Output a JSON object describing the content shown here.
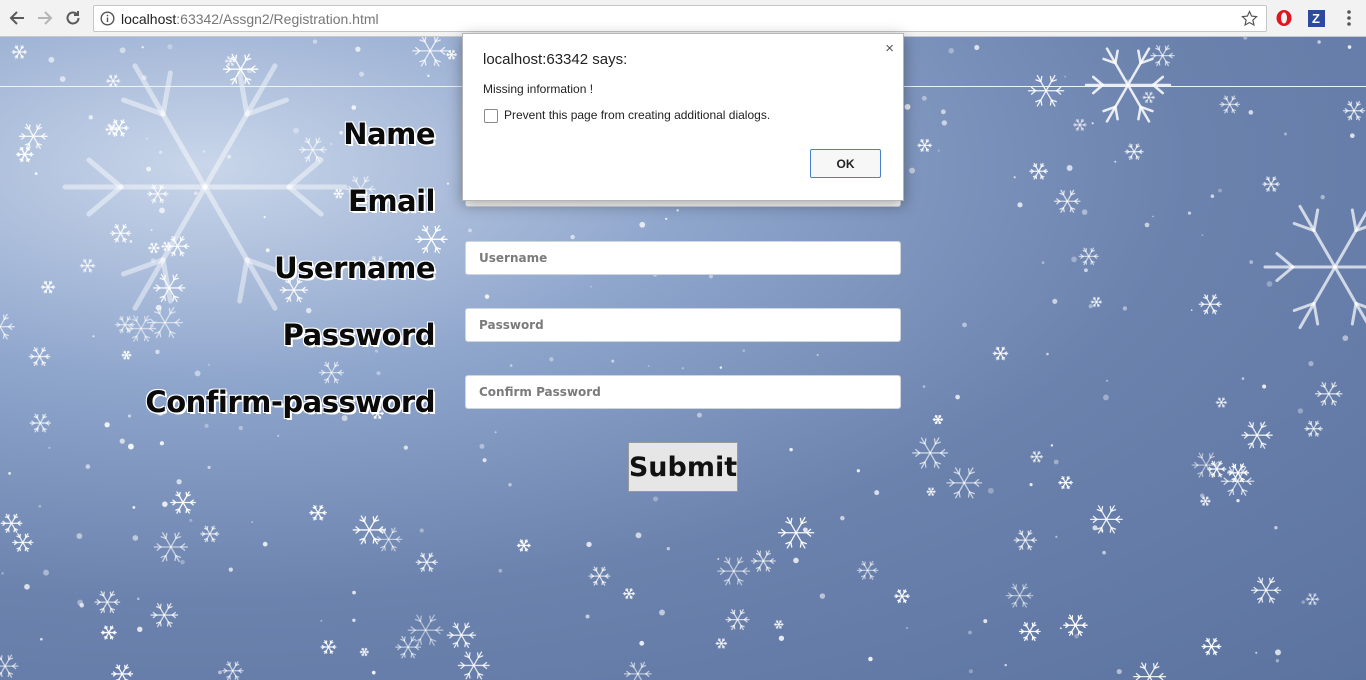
{
  "browser": {
    "url_host": "localhost",
    "url_rest": ":63342/Assgn2/Registration.html",
    "back_icon": "back-arrow-icon",
    "forward_icon": "forward-arrow-icon",
    "reload_icon": "reload-icon",
    "info_icon": "info-icon",
    "star_icon": "star-icon",
    "extensions": [
      "opera-icon",
      "z-extension-icon"
    ],
    "menu_icon": "menu-dots-icon",
    "z_label": "Z"
  },
  "form": {
    "labels": {
      "name": "Name",
      "email": "Email",
      "username": "Username",
      "password": "Password",
      "confirm": "Confirm-password"
    },
    "placeholders": {
      "username": "Username",
      "password": "Password",
      "confirm": "Confirm Password"
    },
    "submit_label": "Submit"
  },
  "dialog": {
    "title": "localhost:63342 says:",
    "close_glyph": "×",
    "message": "Missing information !",
    "checkbox_label": "Prevent this page from creating additional dialogs.",
    "ok_label": "OK"
  },
  "colors": {
    "background_accent": "#6b82ad",
    "ok_border": "#4a7fd1"
  }
}
